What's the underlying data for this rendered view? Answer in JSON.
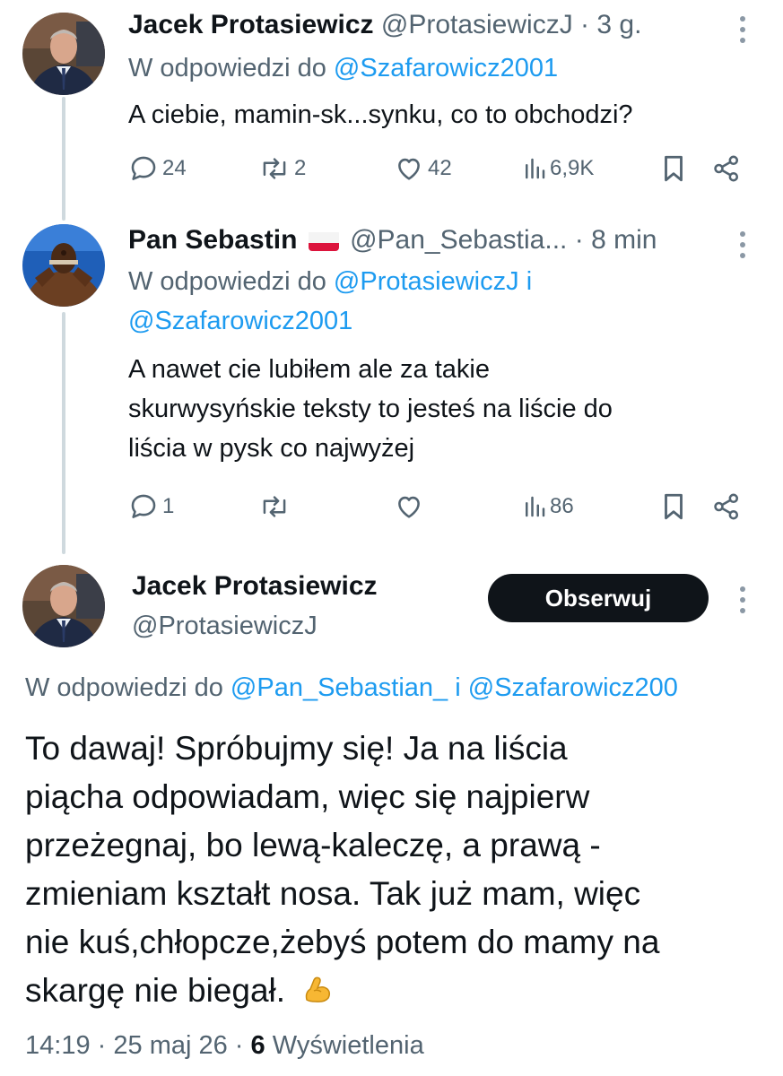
{
  "tweet1": {
    "author_name": "Jacek Protasiewicz",
    "handle": "@ProtasiewiczJ",
    "dot": "·",
    "time": "3 g.",
    "reply_prefix": "W odpowiedzi do",
    "reply_handle": "@Szafarowicz2001",
    "text": "A ciebie, mamin-sk...synku, co to obchodzi?",
    "replies": "24",
    "reposts": "2",
    "likes": "42",
    "views": "6,9K"
  },
  "tweet2": {
    "author_name": "Pan Sebastin",
    "flag_icon": "poland-flag-icon",
    "handle": "@Pan_Sebastia...",
    "dot": "·",
    "time": "8 min",
    "reply_prefix": "W odpowiedzi do",
    "reply_handle_1": "@ProtasiewiczJ",
    "reply_and": "i",
    "reply_handle_2": "@Szafarowicz2001",
    "text_lines": [
      "A nawet cie lubiłem ale za takie",
      "skurwysyńskie teksty to jesteś na liście do",
      "liścia w pysk co najwyżej"
    ],
    "replies": "1",
    "reposts": "",
    "likes": "",
    "views": "86"
  },
  "main_tweet": {
    "author_name": "Jacek Protasiewicz",
    "handle": "@ProtasiewiczJ",
    "follow_label": "Obserwuj",
    "reply_prefix": "W odpowiedzi do",
    "reply_handle_1": "@Pan_Sebastian_",
    "reply_and": "i",
    "reply_handle_2": "@Szafarowicz200",
    "text_lines": [
      "To dawaj! Spróbujmy się! Ja na liścia",
      "piącha odpowiadam, więc się najpierw",
      "przeżegnaj, bo lewą-kaleczę, a prawą -",
      "zmieniam kształt nosa. Tak już mam, więc",
      "nie kuś,chłopcze,żebyś potem do mamy na",
      "skargę nie biegał."
    ],
    "emoji": "flexed-biceps-icon",
    "time": "14:19",
    "dot1": "·",
    "date": "25 maj 26",
    "dot2": "·",
    "views_count": "6",
    "views_label": "Wyświetlenia"
  },
  "colors": {
    "link": "#1d9bf0",
    "muted": "#536471",
    "text": "#0f1419",
    "follow_bg": "#0f1419"
  }
}
